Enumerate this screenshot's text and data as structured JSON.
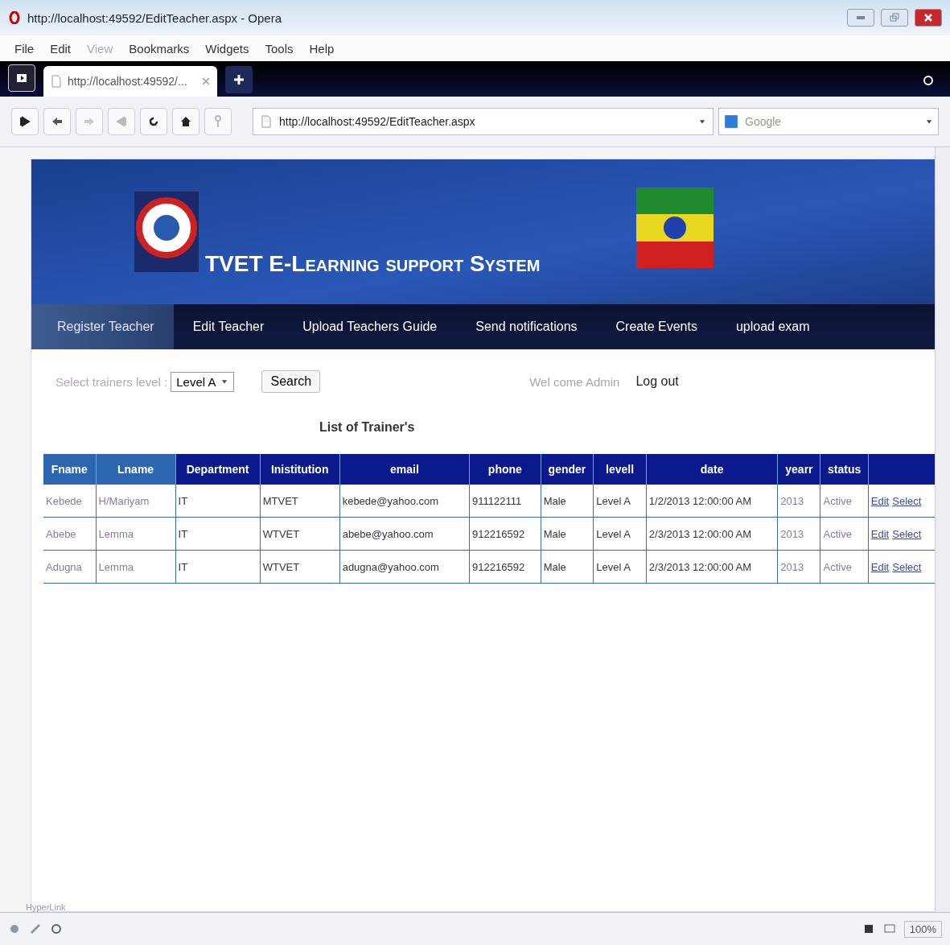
{
  "window": {
    "title": "http://localhost:49592/EditTeacher.aspx - Opera"
  },
  "menu": [
    {
      "label": "File",
      "disabled": false
    },
    {
      "label": "Edit",
      "disabled": false
    },
    {
      "label": "View",
      "disabled": true
    },
    {
      "label": "Bookmarks",
      "disabled": false
    },
    {
      "label": "Widgets",
      "disabled": false
    },
    {
      "label": "Tools",
      "disabled": false
    },
    {
      "label": "Help",
      "disabled": false
    }
  ],
  "tab": {
    "title": "http://localhost:49592/..."
  },
  "address": {
    "value": "http://localhost:49592/EditTeacher.aspx"
  },
  "search_engine": {
    "placeholder": "Google"
  },
  "site": {
    "title": "TVET E-Learning support System"
  },
  "nav": [
    {
      "label": "Register Teacher",
      "selected": true
    },
    {
      "label": "Edit Teacher",
      "selected": false
    },
    {
      "label": "Upload Teachers Guide",
      "selected": false
    },
    {
      "label": "Send notifications",
      "selected": false
    },
    {
      "label": "Create Events",
      "selected": false
    },
    {
      "label": "upload exam",
      "selected": false
    }
  ],
  "filter": {
    "label": "Select trainers level :",
    "value": "Level A",
    "button": "Search"
  },
  "user": {
    "welcome": "Wel come Admin",
    "logout": "Log out"
  },
  "table": {
    "caption": "List of Trainer's",
    "columns": [
      "Fname",
      "Lname",
      "Department",
      "Inistitution",
      "email",
      "phone",
      "gender",
      "levell",
      "date",
      "yearr",
      "status"
    ],
    "rows": [
      {
        "cells": [
          "Kebede",
          "H/Mariyam",
          "IT",
          "MTVET",
          "kebede@yahoo.com",
          "911122111",
          "Male",
          "Level A",
          "1/2/2013 12:00:00 AM",
          "2013",
          "Active"
        ],
        "links": [
          "Edit",
          "Select"
        ]
      },
      {
        "cells": [
          "Abebe",
          "Lemma",
          "IT",
          "WTVET",
          "abebe@yahoo.com",
          "912216592",
          "Male",
          "Level A",
          "2/3/2013 12:00:00 AM",
          "2013",
          "Active"
        ],
        "links": [
          "Edit",
          "Select"
        ]
      },
      {
        "cells": [
          "Adugna",
          "Lemma",
          "IT",
          "WTVET",
          "adugna@yahoo.com",
          "912216592",
          "Male",
          "Level A",
          "2/3/2013 12:00:00 AM",
          "2013",
          "Active"
        ],
        "links": [
          "Edit",
          "Select"
        ]
      }
    ]
  },
  "footer_link": "HyperLink",
  "status_bar": {
    "zoom": "100%"
  }
}
